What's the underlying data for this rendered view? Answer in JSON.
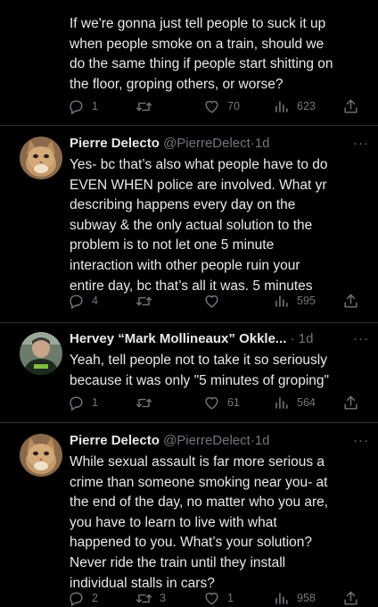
{
  "tweets": [
    {
      "body": "If we're gonna just tell people to suck it up\nwhen people smoke on a train, should we\ndo the same thing if people start shitting on\nthe floor, groping others, or worse?",
      "replies": "1",
      "retweets": "",
      "likes": "70",
      "views": "623"
    },
    {
      "name": "Pierre Delecto",
      "handle": "@PierreDelect",
      "time": "1d",
      "body": "Yes- bc that’s also what people have to do\nEVEN WHEN police are involved. What yr\ndescribing happens every day on the\nsubway & the only actual solution to the\nproblem is to not let one 5 minute\ninteraction with other people ruin your\nentire day, bc that’s all it was. 5 minutes",
      "replies": "4",
      "retweets": "",
      "likes": "",
      "views": "595"
    },
    {
      "name": "Hervey “Mark Mollineaux” Okkle...",
      "handle": "",
      "time": "1d",
      "body": "Yeah, tell people not to take it so seriously\nbecause it was only \"5 minutes of groping\"",
      "replies": "1",
      "retweets": "",
      "likes": "61",
      "views": "564"
    },
    {
      "name": "Pierre Delecto",
      "handle": "@PierreDelect",
      "time": "1d",
      "body": "While sexual assault is far more serious a\ncrime than someone smoking near you- at\nthe end of the day, no matter who you are,\nyou have to learn to live with what\nhappened to you. What’s your solution?\nNever ride the train until they install\nindividual stalls in cars?",
      "replies": "2",
      "retweets": "3",
      "likes": "1",
      "views": "958"
    }
  ],
  "separator": "·",
  "more_label": "···",
  "colors": {
    "background": "#000000",
    "text": "#e7e9ea",
    "muted": "#71767b",
    "divider": "#2f3336"
  },
  "icons": [
    "reply-icon",
    "retweet-icon",
    "like-icon",
    "views-icon",
    "share-icon",
    "more-icon"
  ]
}
